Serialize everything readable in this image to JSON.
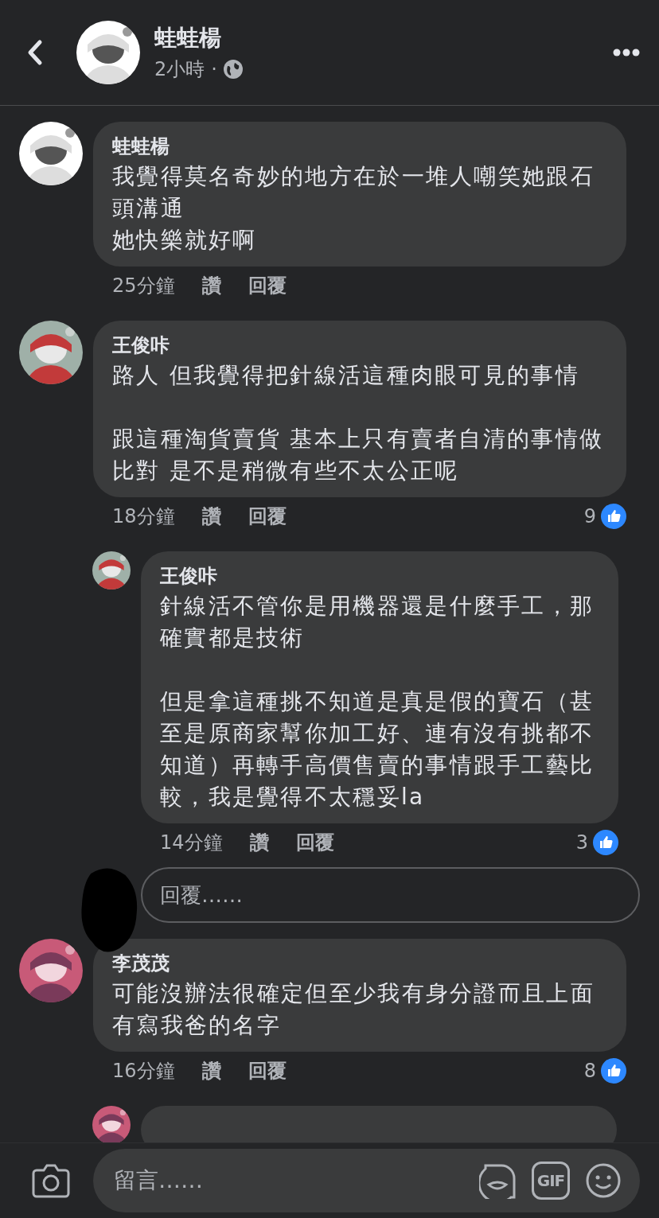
{
  "header": {
    "name": "蛙蛙楊",
    "time": "2小時",
    "separator": "·"
  },
  "comments": [
    {
      "author": "蛙蛙楊",
      "paragraphs": [
        [
          "我覺得莫名奇妙的地方在於一堆人嘲笑她跟石頭溝通",
          "她快樂就好啊"
        ]
      ],
      "time": "25分鐘",
      "like": "讚",
      "reply": "回覆"
    },
    {
      "author": "王俊咔",
      "paragraphs": [
        [
          "路人 但我覺得把針線活這種肉眼可見的事情"
        ],
        [
          "跟這種淘貨賣貨 基本上只有賣者自清的事情做比對 是不是稍微有些不太公正呢"
        ]
      ],
      "time": "18分鐘",
      "like": "讚",
      "reply": "回覆",
      "reactions": "9",
      "replies": [
        {
          "kind": "comment",
          "author": "王俊咔",
          "paragraphs": [
            [
              "針線活不管你是用機器還是什麼手工，那確實都是技術"
            ],
            [
              "但是拿這種挑不知道是真是假的寶石（甚至是原商家幫你加工好、連有沒有挑都不知道）再轉手高價售賣的事情跟手工藝比較，我是覺得不太穩妥la"
            ]
          ],
          "time": "14分鐘",
          "like": "讚",
          "reply": "回覆",
          "reactions": "3"
        }
      ],
      "reply_field": {
        "placeholder": "回覆……"
      }
    },
    {
      "author": "李茂茂",
      "paragraphs": [
        [
          "可能沒辦法很確定但至少我有身分證而且上面有寫我爸的名字"
        ]
      ],
      "time": "16分鐘",
      "like": "讚",
      "reply": "回覆",
      "reactions": "8",
      "replies": [
        {
          "kind": "cut"
        }
      ]
    }
  ],
  "composer": {
    "placeholder": "留言……",
    "gif_label": "GIF"
  }
}
